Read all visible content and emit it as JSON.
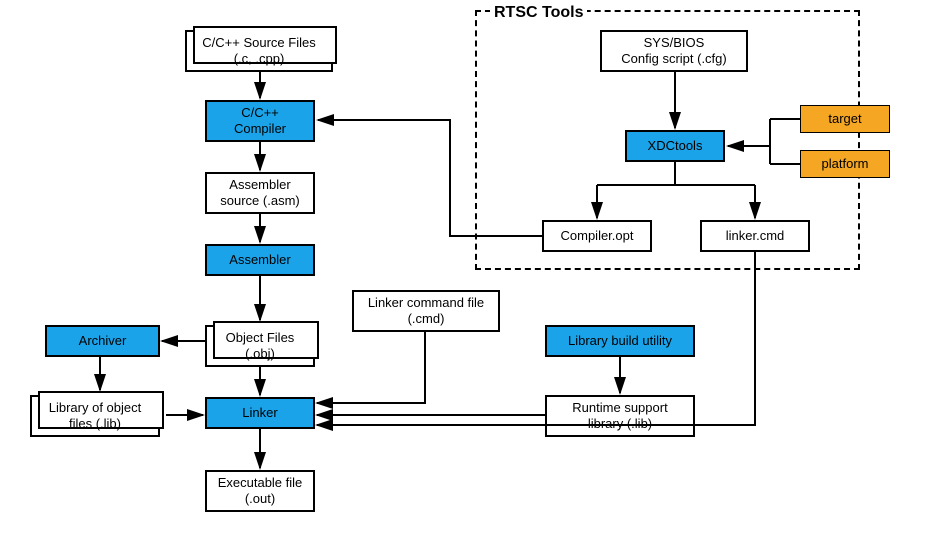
{
  "diagram": {
    "rtsc_title": "RTSC Tools",
    "nodes": {
      "source_files": {
        "line1": "C/C++ Source Files",
        "line2": "(.c, .cpp)"
      },
      "compiler": {
        "line1": "C/C++",
        "line2": "Compiler"
      },
      "asm_source": {
        "line1": "Assembler",
        "line2": "source (.asm)"
      },
      "assembler": {
        "line1": "Assembler"
      },
      "object_files": {
        "line1": "Object Files",
        "line2": "(.obj)"
      },
      "archiver": {
        "line1": "Archiver"
      },
      "obj_lib": {
        "line1": "Library of object",
        "line2": "files (.lib)"
      },
      "linker_cmd": {
        "line1": "Linker command file",
        "line2": "(.cmd)"
      },
      "linker": {
        "line1": "Linker"
      },
      "executable": {
        "line1": "Executable file",
        "line2": "(.out)"
      },
      "sysbios": {
        "line1": "SYS/BIOS",
        "line2": "Config script (.cfg)"
      },
      "xdctools": {
        "line1": "XDCtools"
      },
      "target": {
        "line1": "target"
      },
      "platform": {
        "line1": "platform"
      },
      "compiler_opt": {
        "line1": "Compiler.opt"
      },
      "linker_cmd_out": {
        "line1": "linker.cmd"
      },
      "lib_build": {
        "line1": "Library build utility"
      },
      "runtime_lib": {
        "line1": "Runtime support",
        "line2": "library (.lib)"
      }
    },
    "colors": {
      "process": "#1aa3e8",
      "data": "#ffffff",
      "extern": "#f5a623"
    }
  }
}
